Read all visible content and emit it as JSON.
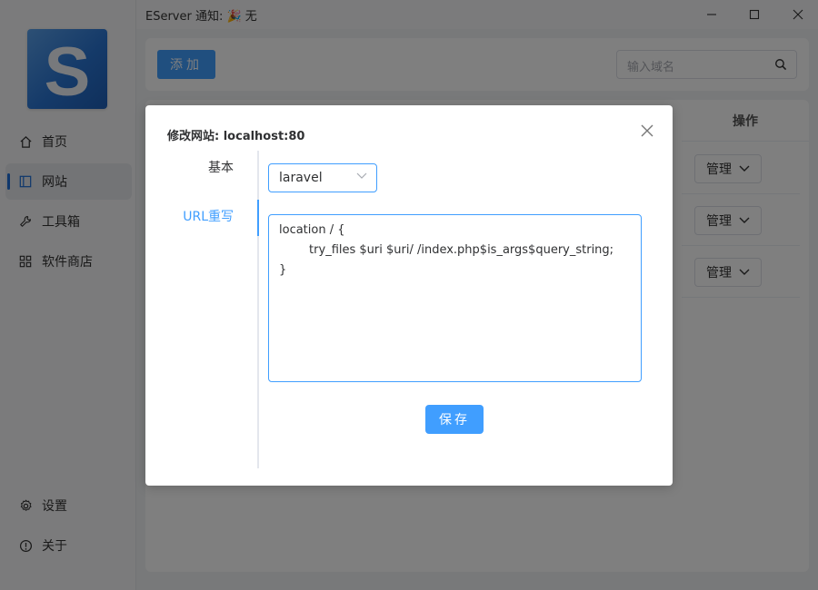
{
  "titlebar": {
    "title": "EServer 通知: 🎉 无"
  },
  "logo": {
    "letter": "S"
  },
  "sidebar": {
    "items": [
      {
        "label": "首页",
        "icon": "home-icon"
      },
      {
        "label": "网站",
        "icon": "website-icon",
        "active": true
      },
      {
        "label": "工具箱",
        "icon": "wrench-icon"
      },
      {
        "label": "软件商店",
        "icon": "grid-icon"
      }
    ],
    "bottom": [
      {
        "label": "设置",
        "icon": "gear-icon"
      },
      {
        "label": "关于",
        "icon": "info-icon"
      }
    ]
  },
  "toolbar": {
    "add_label": "添加",
    "search_placeholder": "输入域名"
  },
  "table": {
    "column_operations": "操作",
    "rows": [
      {
        "action_label": "管理"
      },
      {
        "action_label": "管理"
      },
      {
        "action_label": "管理"
      }
    ]
  },
  "dialog": {
    "title": "修改网站: localhost:80",
    "tabs": [
      {
        "label": "基本"
      },
      {
        "label": "URL重写",
        "active": true
      }
    ],
    "preset_value": "laravel",
    "rewrite_rules": "location / {\n        try_files $uri $uri/ /index.php$is_args$query_string;\n}",
    "save_label": "保存"
  },
  "colors": {
    "primary": "#409eff",
    "logo": "#2a75d3",
    "overlay": "rgba(0,0,0,0.5)"
  }
}
